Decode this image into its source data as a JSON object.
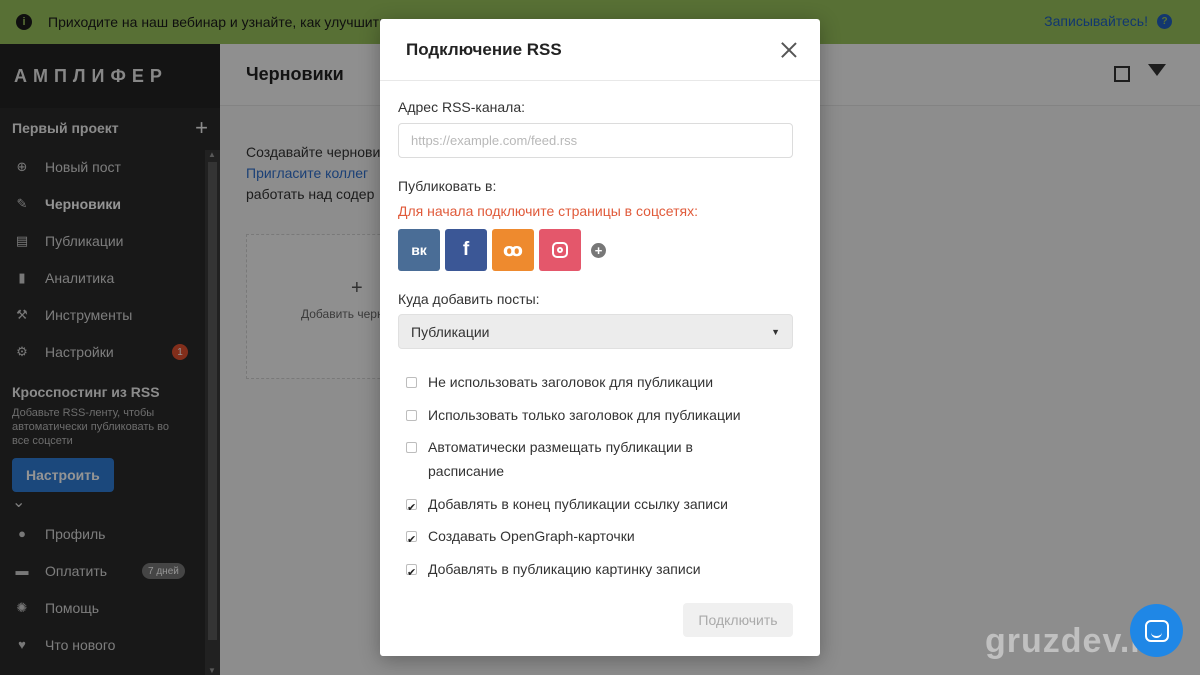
{
  "banner": {
    "text": "Приходите на наш вебинар и узнайте, как улучшить ваши посты в соцсетях и увеличить охват",
    "signup": "Записывайтесь!"
  },
  "sidebar": {
    "logo": "АМПЛИФЕР",
    "project": "Первый проект",
    "items": [
      {
        "label": "Новый пост",
        "icon": "plus-circle-icon"
      },
      {
        "label": "Черновики",
        "icon": "pencil-icon"
      },
      {
        "label": "Публикации",
        "icon": "calendar-icon"
      },
      {
        "label": "Аналитика",
        "icon": "bar-chart-icon"
      },
      {
        "label": "Инструменты",
        "icon": "wrench-icon"
      },
      {
        "label": "Настройки",
        "icon": "gear-icon",
        "badge": "1"
      }
    ],
    "rss": {
      "title": "Кросспостинг из RSS",
      "desc": "Добавьте RSS-ленту, чтобы автоматически публиковать во все соцсети",
      "button": "Настроить"
    },
    "bottom_items": [
      {
        "label": "Профиль",
        "icon": "user-icon"
      },
      {
        "label": "Оплатить",
        "icon": "card-icon",
        "badge": "7 дней"
      },
      {
        "label": "Помощь",
        "icon": "lifebuoy-icon"
      },
      {
        "label": "Что нового",
        "icon": "heart-icon"
      }
    ]
  },
  "main": {
    "title": "Черновики",
    "text_line1": "Создавайте черновики",
    "text_link": "Пригласите коллег",
    "text_line3": "работать над содер",
    "card_label": "Добавить черновик"
  },
  "modal": {
    "title": "Подключение RSS",
    "rss_label": "Адрес RSS-канала:",
    "rss_placeholder": "https://example.com/feed.rss",
    "publish_label": "Публиковать в:",
    "warning": "Для начала подключите страницы в соцсетях:",
    "socials": [
      {
        "name": "vk",
        "glyph": "вк",
        "color": "#4a6d96"
      },
      {
        "name": "facebook",
        "glyph": "f",
        "color": "#3b5796"
      },
      {
        "name": "odnoklassniki",
        "glyph": "ok",
        "color": "#ee8a2e"
      },
      {
        "name": "instagram",
        "glyph": "",
        "color": "#e4576b"
      }
    ],
    "dest_label": "Куда добавить посты:",
    "dest_value": "Публикации",
    "options": [
      {
        "label": "Не использовать заголовок для публикации",
        "checked": false
      },
      {
        "label": "Использовать только заголовок для публикации",
        "checked": false
      },
      {
        "label": "Автоматически размещать публикации в расписание",
        "checked": false
      },
      {
        "label": "Добавлять в конец публикации ссылку записи",
        "checked": true
      },
      {
        "label": "Создавать OpenGraph-карточки",
        "checked": true
      },
      {
        "label": "Добавлять в публикацию картинку записи",
        "checked": true
      }
    ],
    "connect": "Подключить"
  },
  "watermark": "gruzdev.ru"
}
